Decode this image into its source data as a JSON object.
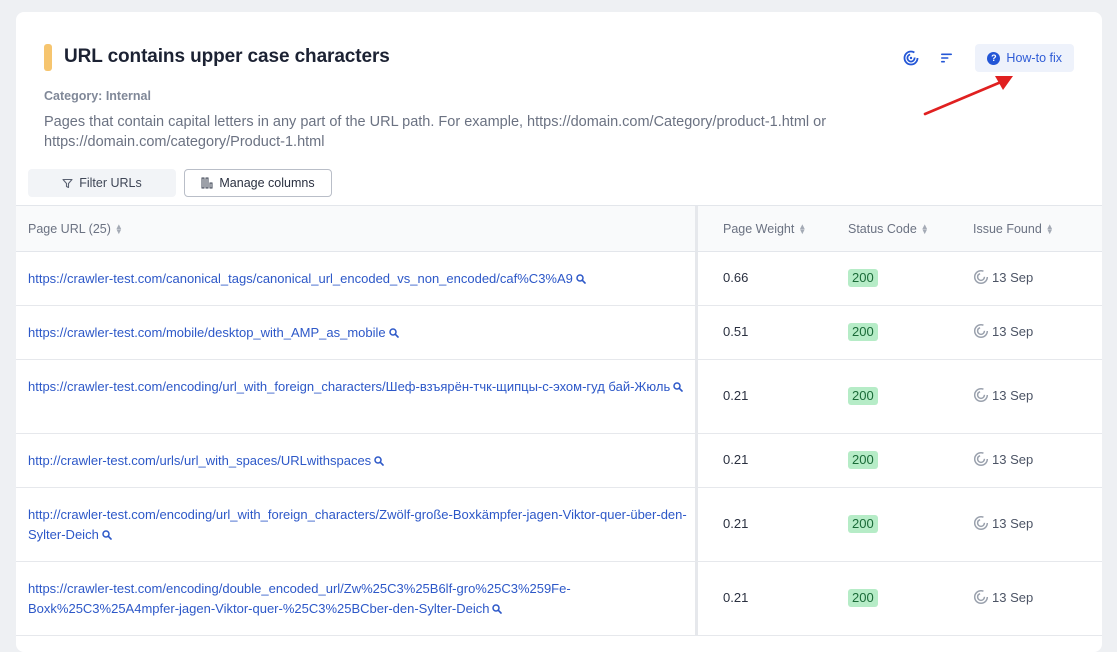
{
  "issue": {
    "title": "URL contains upper case characters",
    "category": "Category: Internal",
    "description": "Pages that contain capital letters in any part of the URL path. For example, https://domain.com/Category/product-1.html or https://domain.com/category/Product-1.html",
    "accent_color": "#f6c56f"
  },
  "actions": {
    "howto_label": "How-to fix",
    "crawl_icon": "crawl-spiral-icon",
    "sort_icon": "sort-lines-icon"
  },
  "toolbar": {
    "filter_label": "Filter URLs",
    "manage_label": "Manage columns"
  },
  "table": {
    "headers": {
      "url": "Page URL (25)",
      "weight": "Page Weight",
      "status": "Status Code",
      "issue": "Issue Found"
    },
    "rows": [
      {
        "url": "https://crawler-test.com/canonical_tags/canonical_url_encoded_vs_non_encoded/caf%C3%A9",
        "weight": "0.66",
        "status": "200",
        "issue_found": "13 Sep"
      },
      {
        "url": "https://crawler-test.com/mobile/desktop_with_AMP_as_mobile",
        "weight": "0.51",
        "status": "200",
        "issue_found": "13 Sep"
      },
      {
        "url": "https://crawler-test.com/encoding/url_with_foreign_characters/Шеф-взъярён-тчк-щипцы-с-эхом-гуд бай-Жюль",
        "weight": "0.21",
        "status": "200",
        "issue_found": "13 Sep"
      },
      {
        "url": "http://crawler-test.com/urls/url_with_spaces/URLwithspaces",
        "weight": "0.21",
        "status": "200",
        "issue_found": "13 Sep"
      },
      {
        "url": "http://crawler-test.com/encoding/url_with_foreign_characters/Zwölf-große-Boxkämpfer-jagen-Viktor-quer-über-den-Sylter-Deich",
        "weight": "0.21",
        "status": "200",
        "issue_found": "13 Sep"
      },
      {
        "url": "https://crawler-test.com/encoding/double_encoded_url/Zw%25C3%25B6lf-gro%25C3%259Fe-Boxk%25C3%25A4mpfer-jagen-Viktor-quer-%25C3%25BCber-den-Sylter-Deich",
        "weight": "0.21",
        "status": "200",
        "issue_found": "13 Sep"
      }
    ]
  }
}
